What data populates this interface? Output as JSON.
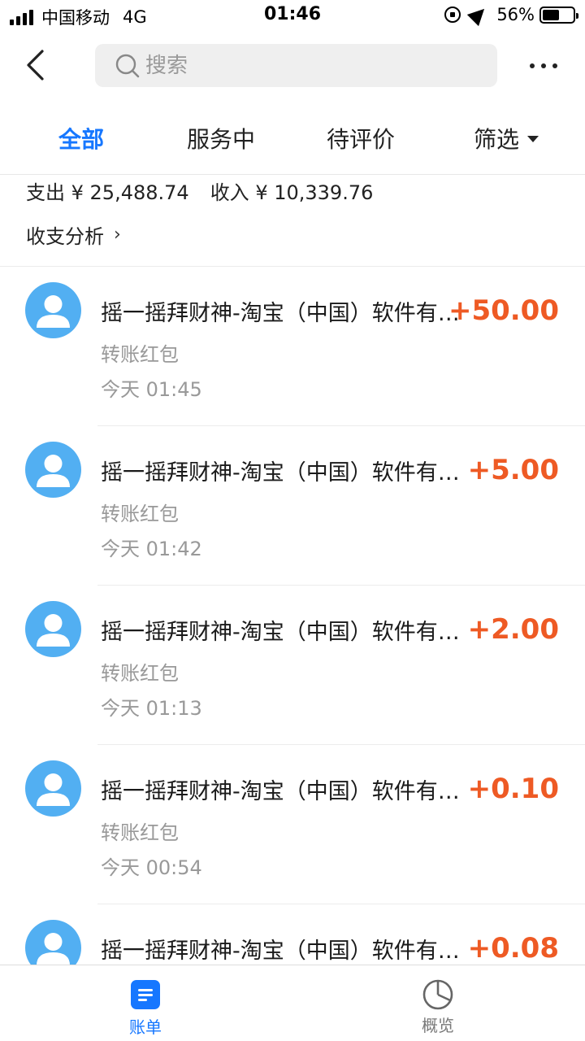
{
  "status_bar": {
    "carrier": "中国移动",
    "network": "4G",
    "time": "01:46",
    "battery_percent": "56%",
    "battery_level": 0.56
  },
  "nav": {
    "search_placeholder": "搜索"
  },
  "tabs": [
    {
      "label": "全部",
      "active": true
    },
    {
      "label": "服务中",
      "active": false
    },
    {
      "label": "待评价",
      "active": false
    },
    {
      "label": "筛选",
      "active": false
    }
  ],
  "summary": {
    "expense_label": "支出",
    "expense_value": "¥ 25,488.74",
    "income_label": "收入",
    "income_value": "¥ 10,339.76",
    "analysis_label": "收支分析"
  },
  "records": [
    {
      "title": "摇一摇拜财神-淘宝（中国）软件有限公司",
      "type": "转账红包",
      "time": "今天  01:45",
      "amount": "+50.00"
    },
    {
      "title": "摇一摇拜财神-淘宝（中国）软件有限公司",
      "type": "转账红包",
      "time": "今天  01:42",
      "amount": "+5.00"
    },
    {
      "title": "摇一摇拜财神-淘宝（中国）软件有限公司",
      "type": "转账红包",
      "time": "今天  01:13",
      "amount": "+2.00"
    },
    {
      "title": "摇一摇拜财神-淘宝（中国）软件有限公司",
      "type": "转账红包",
      "time": "今天  00:54",
      "amount": "+0.10"
    },
    {
      "title": "摇一摇拜财神-淘宝（中国）软件有限公司",
      "type": "",
      "time": "",
      "amount": "+0.08"
    }
  ],
  "tabbar": {
    "bill_label": "账单",
    "overview_label": "概览"
  },
  "colors": {
    "accent": "#1677ff",
    "amount": "#ee5a24",
    "avatar": "#52aff2"
  }
}
